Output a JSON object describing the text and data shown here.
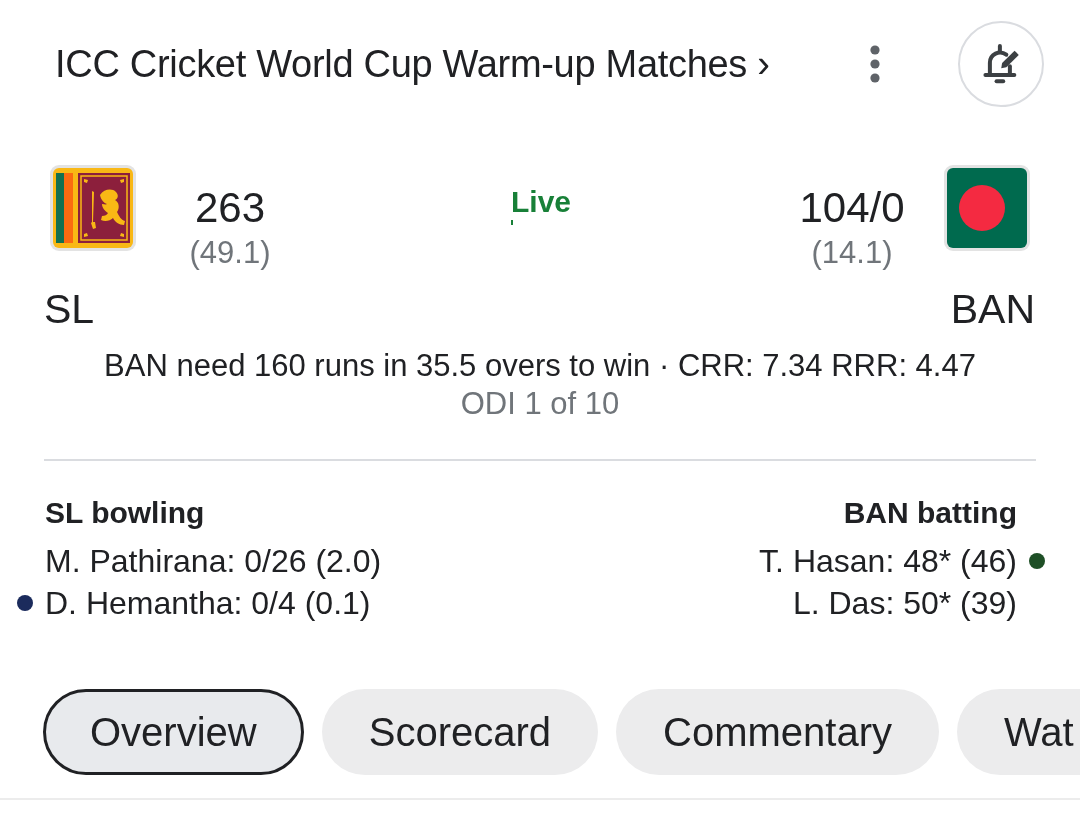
{
  "header": {
    "title": "ICC Cricket World Cup Warm-up Matches ›"
  },
  "match": {
    "status": "Live",
    "teams": [
      {
        "abbr": "SL",
        "score": "263",
        "overs": "(49.1)"
      },
      {
        "abbr": "BAN",
        "score": "104/0",
        "overs": "(14.1)"
      }
    ],
    "summary": "BAN need 160 runs in 35.5 overs to win · CRR: 7.34 RRR: 4.47",
    "series": "ODI 1 of 10"
  },
  "panels": [
    {
      "title": "SL bowling",
      "color": "#1b2b5c",
      "players": [
        {
          "text": "M. Pathirana: 0/26 (2.0)",
          "current": false
        },
        {
          "text": "D. Hemantha: 0/4 (0.1)",
          "current": true
        }
      ]
    },
    {
      "title": "BAN batting",
      "color": "#1e4f26",
      "players": [
        {
          "text": "T. Hasan: 48* (46)",
          "current": true
        },
        {
          "text": "L. Das: 50* (39)",
          "current": false
        }
      ]
    }
  ],
  "tabs": [
    {
      "label": "Overview",
      "selected": true
    },
    {
      "label": "Scorecard",
      "selected": false
    },
    {
      "label": "Commentary",
      "selected": false
    },
    {
      "label": "Wat",
      "selected": false
    }
  ]
}
